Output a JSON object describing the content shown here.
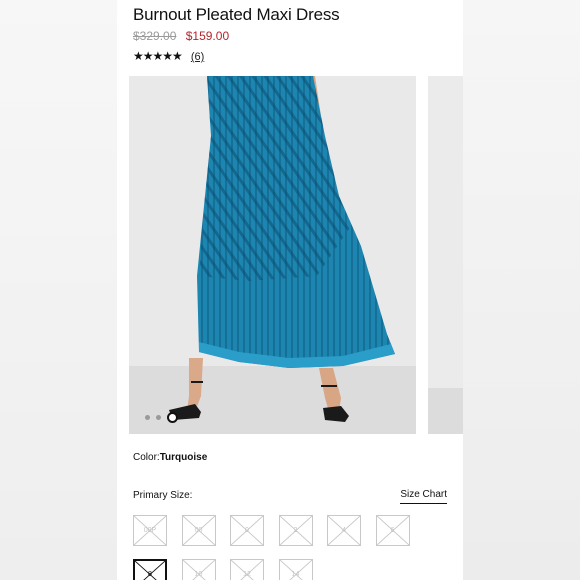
{
  "product": {
    "title": "Burnout Pleated Maxi Dress",
    "original_price": "$329.00",
    "sale_price": "$159.00",
    "rating_stars": "★★★★★",
    "review_count": "(6)"
  },
  "carousel": {
    "dress_color": "#1d86b0",
    "slide_count": 3,
    "active_slide": 3
  },
  "color": {
    "label": "Color:",
    "value": "Turquoise"
  },
  "size": {
    "label": "Primary Size:",
    "chart_link": "Size Chart",
    "options": [
      "00P",
      "00",
      "0",
      "2",
      "4",
      "6",
      "8",
      "10",
      "12",
      "14"
    ],
    "selected_index": 6
  },
  "chat": {
    "icon": "chat-icon"
  },
  "colors": {
    "sale_price": "#b3242c",
    "dress": "#1d86b0",
    "chat_bg": "#222222"
  }
}
